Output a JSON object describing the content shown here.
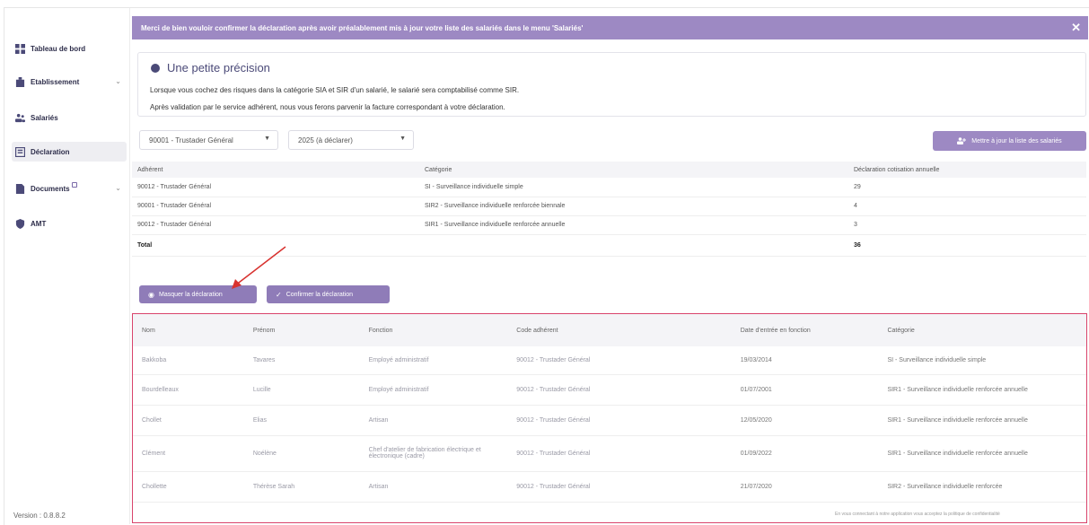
{
  "sidebar": {
    "items": [
      {
        "label": "Tableau de bord",
        "icon": "dashboard-icon"
      },
      {
        "label": "Etablissement",
        "icon": "building-icon",
        "chevron": "⌄"
      },
      {
        "label": "Salariés",
        "icon": "users-icon"
      },
      {
        "label": "Déclaration",
        "icon": "declaration-icon"
      },
      {
        "label": "Documents",
        "icon": "document-icon",
        "chevron": "⌄"
      },
      {
        "label": "AMT",
        "icon": "shield-icon"
      }
    ],
    "version": "Version : 0.8.8.2"
  },
  "banner": {
    "text": "Merci de bien vouloir confirmer la déclaration après avoir préalablement mis à jour votre liste des salariés dans le menu 'Salariés'",
    "close": "✕"
  },
  "info": {
    "title": "Une petite précision",
    "line1": "Lorsque vous cochez des risques dans la catégorie SIA et SIR d'un salarié, le salarié sera comptabilisé comme SIR.",
    "line2": "Après validation par le service adhérent, nous vous ferons parvenir la facture correspondant à votre déclaration."
  },
  "filters": {
    "adherent_value": "90001 - Trustader Général",
    "year_value": "2025 (à déclarer)"
  },
  "update_button": "Mettre à jour la liste des salariés",
  "summary": {
    "headers": [
      "Adhérent",
      "Catégorie",
      "Déclaration cotisation annuelle"
    ],
    "rows": [
      [
        "90012 - Trustader Général",
        "SI - Surveillance individuelle simple",
        "29"
      ],
      [
        "90001 - Trustader Général",
        "SIR2 - Surveillance individuelle renforcée biennale",
        "4"
      ],
      [
        "90012 - Trustader Général",
        "SIR1 - Surveillance individuelle renforcée annuelle",
        "3"
      ]
    ],
    "total_label": "Total",
    "total_value": "36"
  },
  "actions": {
    "hide_label": "Masquer la déclaration",
    "confirm_label": "Confirmer la déclaration"
  },
  "employees": {
    "headers": [
      "Nom",
      "Prénom",
      "Fonction",
      "Code adhérent",
      "Date d'entrée en fonction",
      "Catégorie"
    ],
    "rows": [
      [
        "Bakkoba",
        "Tavares",
        "Employé administratif",
        "90012 - Trustader Général",
        "19/03/2014",
        "SI - Surveillance individuelle simple"
      ],
      [
        "Bourdelleaux",
        "Lucille",
        "Employé administratif",
        "90012 - Trustader Général",
        "01/07/2001",
        "SIR1 - Surveillance individuelle renforcée annuelle"
      ],
      [
        "Chollet",
        "Elias",
        "Artisan",
        "90012 - Trustader Général",
        "12/05/2020",
        "SIR1 - Surveillance individuelle renforcée annuelle"
      ],
      [
        "Clément",
        "Noélène",
        "Chef d'atelier de fabrication électrique et électronique (cadre)",
        "90012 - Trustader Général",
        "01/09/2022",
        "SIR1 - Surveillance individuelle renforcée annuelle"
      ],
      [
        "Chollette",
        "Thérèse Sarah",
        "Artisan",
        "90012 - Trustader Général",
        "21/07/2020",
        "SIR2 - Surveillance individuelle renforcée"
      ]
    ]
  },
  "footnote": "En vous connectant à notre application vous acceptez la politique de confidentialité"
}
